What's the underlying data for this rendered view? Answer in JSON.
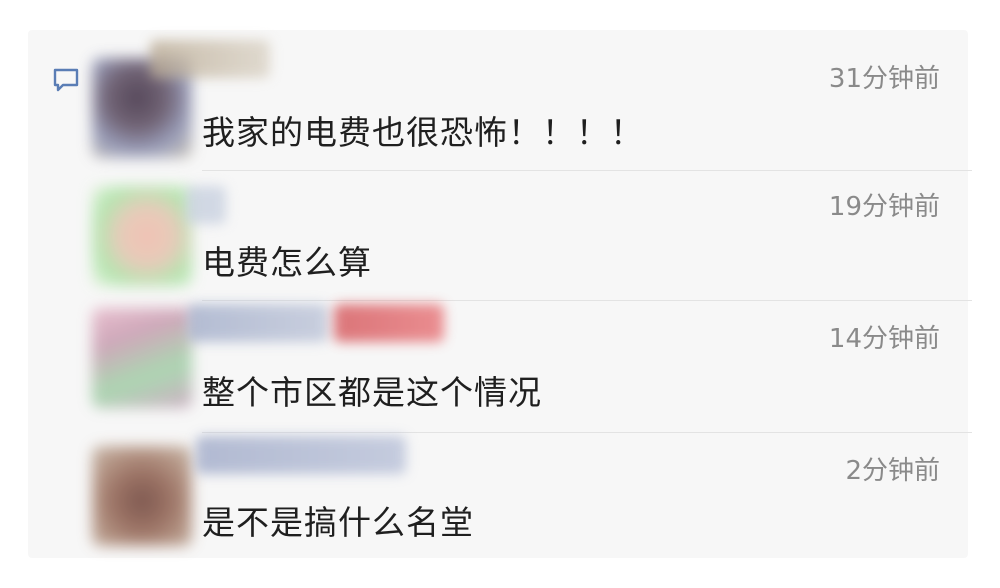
{
  "comments": [
    {
      "message": "我家的电费也很恐怖！！！！",
      "time": "31分钟前"
    },
    {
      "message": "电费怎么算",
      "time": "19分钟前"
    },
    {
      "message": "整个市区都是这个情况",
      "time": "14分钟前"
    },
    {
      "message": "是不是搞什么名堂",
      "time": "2分钟前"
    }
  ],
  "icons": {
    "comment": "comment-bubble-icon"
  },
  "colors": {
    "panel_bg": "#f7f7f7",
    "text": "#1f1f1f",
    "time_text": "#8a8a8a",
    "icon": "#5a7db5"
  }
}
